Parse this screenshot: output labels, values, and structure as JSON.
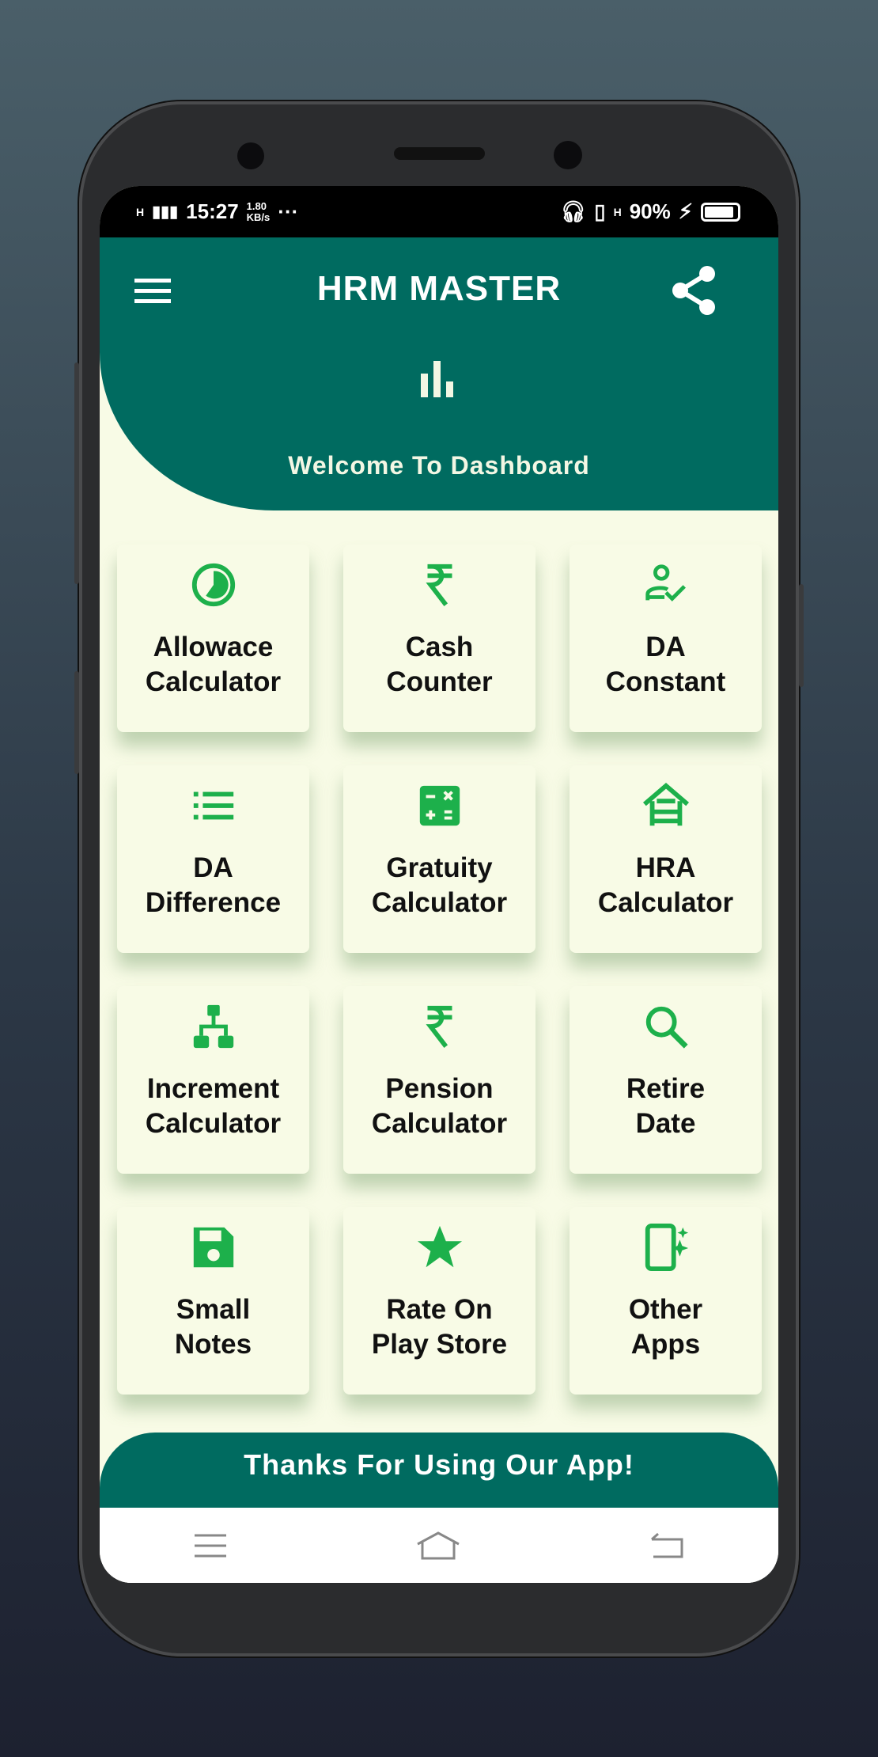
{
  "status_bar": {
    "network": "H",
    "time": "15:27",
    "speed": "1.80",
    "speed_unit": "KB/s",
    "more": "···",
    "network2": "H",
    "battery": "90%"
  },
  "header": {
    "title": "HRM MASTER",
    "welcome": "Welcome To Dashboard",
    "icons": [
      "menu-icon",
      "share-icon",
      "bar-chart-icon"
    ]
  },
  "colors": {
    "primary": "#006b60",
    "accent": "#1db04b",
    "background": "#f8fbe6"
  },
  "cards": [
    {
      "line1": "Allowace",
      "line2": "Calculator",
      "icon": "pie-clock-icon"
    },
    {
      "line1": "Cash",
      "line2": "Counter",
      "icon": "rupee-icon"
    },
    {
      "line1": "DA",
      "line2": "Constant",
      "icon": "user-check-icon"
    },
    {
      "line1": "DA",
      "line2": "Difference",
      "icon": "list-icon"
    },
    {
      "line1": "Gratuity",
      "line2": "Calculator",
      "icon": "calculator-icon"
    },
    {
      "line1": "HRA",
      "line2": "Calculator",
      "icon": "house-icon"
    },
    {
      "line1": "Increment",
      "line2": "Calculator",
      "icon": "hierarchy-icon"
    },
    {
      "line1": "Pension",
      "line2": "Calculator",
      "icon": "rupee-icon"
    },
    {
      "line1": "Retire",
      "line2": "Date",
      "icon": "search-icon"
    },
    {
      "line1": "Small",
      "line2": "Notes",
      "icon": "save-icon"
    },
    {
      "line1": "Rate On",
      "line2": "Play Store",
      "icon": "star-icon"
    },
    {
      "line1": "Other",
      "line2": "Apps",
      "icon": "phone-sparkle-icon"
    }
  ],
  "footer": {
    "text": "Thanks For Using Our App!"
  }
}
